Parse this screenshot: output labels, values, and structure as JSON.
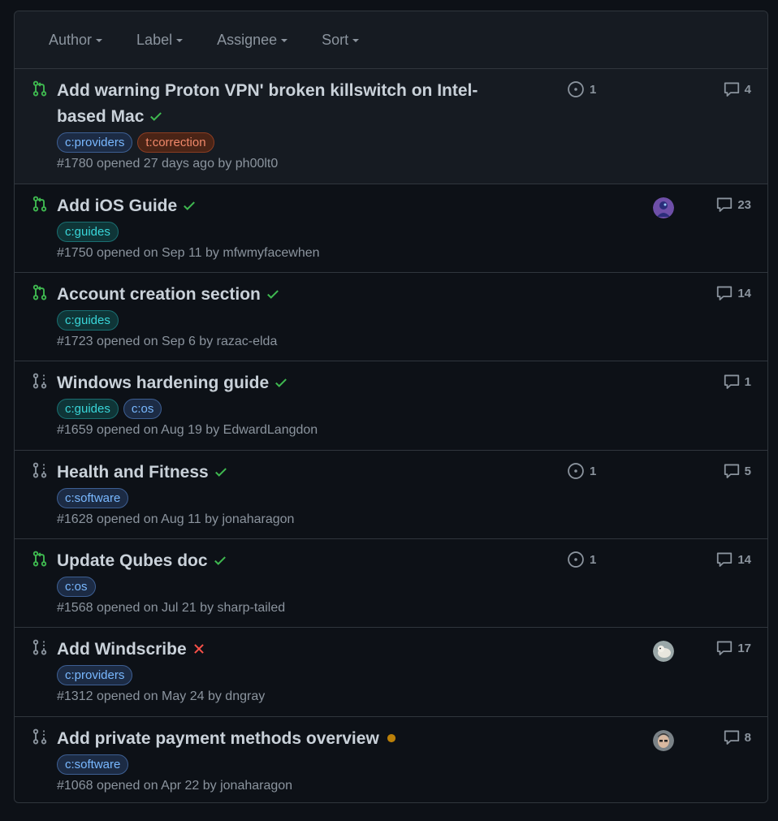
{
  "filters": [
    {
      "label": "Author"
    },
    {
      "label": "Label"
    },
    {
      "label": "Assignee"
    },
    {
      "label": "Sort"
    }
  ],
  "rows": [
    {
      "state": "open",
      "title": "Add warning Proton VPN' broken killswitch on Intel-based Mac",
      "status": "success",
      "labels": [
        {
          "text": "c:providers",
          "cls": "lbl-providers"
        },
        {
          "text": "t:correction",
          "cls": "lbl-correction"
        }
      ],
      "number": "#1780",
      "opened": "opened 27 days ago by",
      "author": "ph00lt0",
      "linked_issues": "1",
      "avatar": "",
      "comments": "4"
    },
    {
      "state": "open",
      "title": "Add iOS Guide",
      "status": "success",
      "labels": [
        {
          "text": "c:guides",
          "cls": "lbl-guides"
        }
      ],
      "number": "#1750",
      "opened": "opened on Sep 11 by",
      "author": "mfwmyfacewhen",
      "linked_issues": "",
      "avatar": "purple",
      "comments": "23"
    },
    {
      "state": "open",
      "title": "Account creation section",
      "status": "success",
      "labels": [
        {
          "text": "c:guides",
          "cls": "lbl-guides"
        }
      ],
      "number": "#1723",
      "opened": "opened on Sep 6 by",
      "author": "razac-elda",
      "linked_issues": "",
      "avatar": "",
      "comments": "14"
    },
    {
      "state": "draft",
      "title": "Windows hardening guide",
      "status": "success",
      "labels": [
        {
          "text": "c:guides",
          "cls": "lbl-guides"
        },
        {
          "text": "c:os",
          "cls": "lbl-os"
        }
      ],
      "number": "#1659",
      "opened": "opened on Aug 19 by",
      "author": "EdwardLangdon",
      "linked_issues": "",
      "avatar": "",
      "comments": "1"
    },
    {
      "state": "draft",
      "title": "Health and Fitness",
      "status": "success",
      "labels": [
        {
          "text": "c:software",
          "cls": "lbl-software"
        }
      ],
      "number": "#1628",
      "opened": "opened on Aug 11 by",
      "author": "jonaharagon",
      "linked_issues": "1",
      "avatar": "",
      "comments": "5"
    },
    {
      "state": "open",
      "title": "Update Qubes doc",
      "status": "success",
      "labels": [
        {
          "text": "c:os",
          "cls": "lbl-os"
        }
      ],
      "number": "#1568",
      "opened": "opened on Jul 21 by",
      "author": "sharp-tailed",
      "linked_issues": "1",
      "avatar": "",
      "comments": "14"
    },
    {
      "state": "draft",
      "title": "Add Windscribe",
      "status": "failure",
      "labels": [
        {
          "text": "c:providers",
          "cls": "lbl-providers"
        }
      ],
      "number": "#1312",
      "opened": "opened on May 24 by",
      "author": "dngray",
      "linked_issues": "",
      "avatar": "bird",
      "comments": "17"
    },
    {
      "state": "draft",
      "title": "Add private payment methods overview",
      "status": "pending",
      "labels": [
        {
          "text": "c:software",
          "cls": "lbl-software"
        }
      ],
      "number": "#1068",
      "opened": "opened on Apr 22 by",
      "author": "jonaharagon",
      "linked_issues": "",
      "avatar": "face",
      "comments": "8"
    }
  ],
  "colors": {
    "open": "#3fb950",
    "draft": "#8b949e",
    "success": "#3fb950",
    "failure": "#f85149",
    "pending": "#bb8009"
  }
}
